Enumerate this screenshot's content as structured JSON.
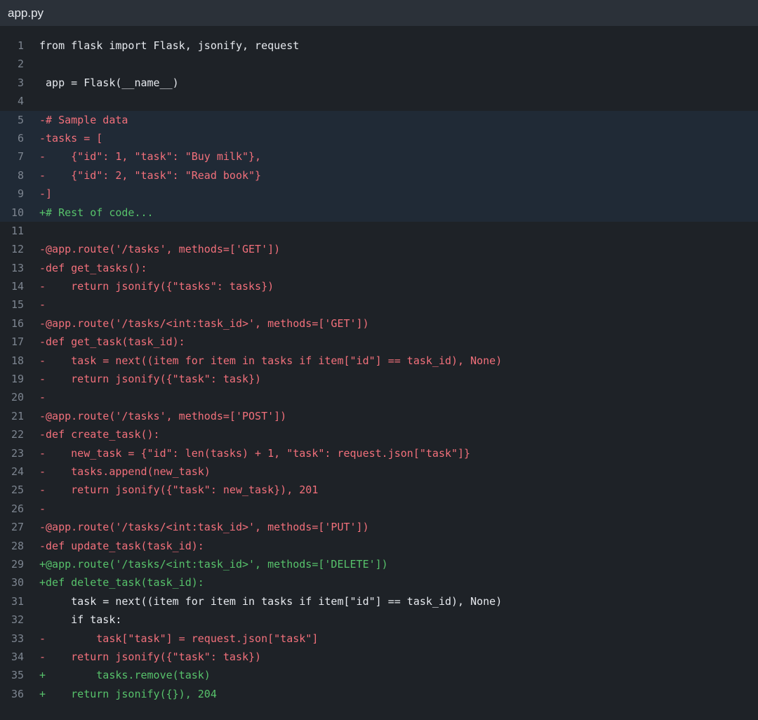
{
  "file": {
    "name": "app.py"
  },
  "colors": {
    "background": "#1e2227",
    "header": "#2b3139",
    "deleted": "#f2707b",
    "added": "#57c26b",
    "line_number": "#7d8590",
    "highlight": "#202a36"
  },
  "lines": [
    {
      "n": "1",
      "text": "from flask import Flask, jsonify, request",
      "kind": "normal"
    },
    {
      "n": "2",
      "text": "",
      "kind": "normal"
    },
    {
      "n": "3",
      "text": " app = Flask(__name__)",
      "kind": "normal"
    },
    {
      "n": "4",
      "text": "",
      "kind": "normal"
    },
    {
      "n": "5",
      "text": "-# Sample data",
      "kind": "del",
      "hl": true
    },
    {
      "n": "6",
      "text": "-tasks = [",
      "kind": "del",
      "hl": true
    },
    {
      "n": "7",
      "text": "-    {\"id\": 1, \"task\": \"Buy milk\"},",
      "kind": "del",
      "hl": true
    },
    {
      "n": "8",
      "text": "-    {\"id\": 2, \"task\": \"Read book\"}",
      "kind": "del",
      "hl": true
    },
    {
      "n": "9",
      "text": "-]",
      "kind": "del",
      "hl": true
    },
    {
      "n": "10",
      "text": "+# Rest of code...",
      "kind": "add",
      "hl": true
    },
    {
      "n": "11",
      "text": "",
      "kind": "normal"
    },
    {
      "n": "12",
      "text": "-@app.route('/tasks', methods=['GET'])",
      "kind": "del"
    },
    {
      "n": "13",
      "text": "-def get_tasks():",
      "kind": "del"
    },
    {
      "n": "14",
      "text": "-    return jsonify({\"tasks\": tasks})",
      "kind": "del"
    },
    {
      "n": "15",
      "text": "-",
      "kind": "del"
    },
    {
      "n": "16",
      "text": "-@app.route('/tasks/<int:task_id>', methods=['GET'])",
      "kind": "del"
    },
    {
      "n": "17",
      "text": "-def get_task(task_id):",
      "kind": "del"
    },
    {
      "n": "18",
      "text": "-    task = next((item for item in tasks if item[\"id\"] == task_id), None)",
      "kind": "del"
    },
    {
      "n": "19",
      "text": "-    return jsonify({\"task\": task})",
      "kind": "del"
    },
    {
      "n": "20",
      "text": "-",
      "kind": "del"
    },
    {
      "n": "21",
      "text": "-@app.route('/tasks', methods=['POST'])",
      "kind": "del"
    },
    {
      "n": "22",
      "text": "-def create_task():",
      "kind": "del"
    },
    {
      "n": "23",
      "text": "-    new_task = {\"id\": len(tasks) + 1, \"task\": request.json[\"task\"]}",
      "kind": "del"
    },
    {
      "n": "24",
      "text": "-    tasks.append(new_task)",
      "kind": "del"
    },
    {
      "n": "25",
      "text": "-    return jsonify({\"task\": new_task}), 201",
      "kind": "del"
    },
    {
      "n": "26",
      "text": "-",
      "kind": "del"
    },
    {
      "n": "27",
      "text": "-@app.route('/tasks/<int:task_id>', methods=['PUT'])",
      "kind": "del"
    },
    {
      "n": "28",
      "text": "-def update_task(task_id):",
      "kind": "del"
    },
    {
      "n": "29",
      "text": "+@app.route('/tasks/<int:task_id>', methods=['DELETE'])",
      "kind": "add"
    },
    {
      "n": "30",
      "text": "+def delete_task(task_id):",
      "kind": "add"
    },
    {
      "n": "31",
      "text": "     task = next((item for item in tasks if item[\"id\"] == task_id), None)",
      "kind": "normal"
    },
    {
      "n": "32",
      "text": "     if task:",
      "kind": "normal"
    },
    {
      "n": "33",
      "text": "-        task[\"task\"] = request.json[\"task\"]",
      "kind": "del"
    },
    {
      "n": "34",
      "text": "-    return jsonify({\"task\": task})",
      "kind": "del"
    },
    {
      "n": "35",
      "text": "+        tasks.remove(task)",
      "kind": "add"
    },
    {
      "n": "36",
      "text": "+    return jsonify({}), 204",
      "kind": "add"
    }
  ]
}
